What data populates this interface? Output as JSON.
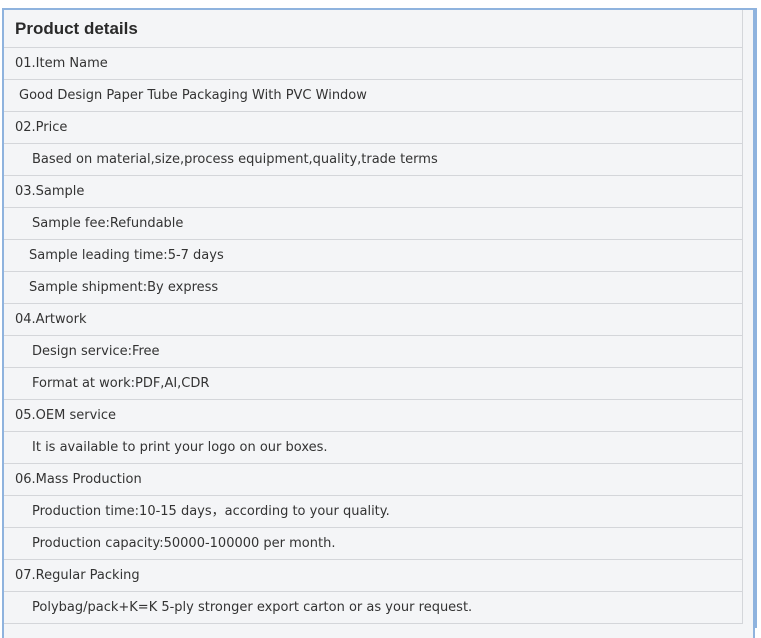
{
  "section": {
    "title": "Product details"
  },
  "rows": [
    {
      "text": "01.Item Name",
      "style": "heading"
    },
    {
      "text": "Good Design Paper Tube Packaging With PVC Window",
      "style": "indent-s"
    },
    {
      "text": "02.Price",
      "style": "heading"
    },
    {
      "text": "Based on material,size,process equipment,quality,trade terms",
      "style": "indent-l"
    },
    {
      "text": "03.Sample",
      "style": "heading"
    },
    {
      "text": "Sample fee:Refundable",
      "style": "indent-l"
    },
    {
      "text": "Sample leading time:5-7 days",
      "style": "indent-m"
    },
    {
      "text": "Sample shipment:By express",
      "style": "indent-m"
    },
    {
      "text": "04.Artwork",
      "style": "heading"
    },
    {
      "text": "Design service:Free",
      "style": "indent-l"
    },
    {
      "text": "Format at work:PDF,AI,CDR",
      "style": "indent-l"
    },
    {
      "text": "05.OEM service",
      "style": "heading"
    },
    {
      "text": "It is available to print your logo on our boxes.",
      "style": "indent-l"
    },
    {
      "text": "06.Mass Production",
      "style": "heading"
    },
    {
      "text": "Production time:10-15 days，according to your quality.",
      "style": "indent-l"
    },
    {
      "text": "Production capacity:50000-100000 per month.",
      "style": "indent-l"
    },
    {
      "text": "07.Regular Packing",
      "style": "heading"
    },
    {
      "text": "Polybag/pack+K=K 5-ply stronger export carton or as your request.",
      "style": "indent-l"
    }
  ]
}
